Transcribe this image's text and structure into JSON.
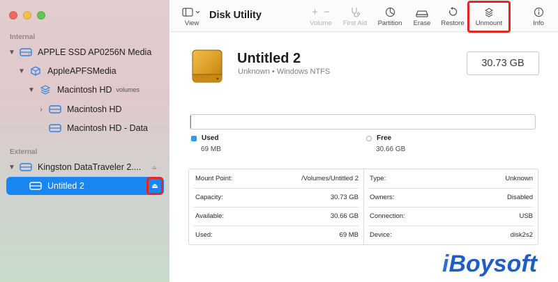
{
  "window": {
    "title": "Disk Utility"
  },
  "toolbar": {
    "view": "View",
    "volume": "Volume",
    "first_aid": "First Aid",
    "partition": "Partition",
    "erase": "Erase",
    "restore": "Restore",
    "unmount": "Unmount",
    "info": "Info"
  },
  "sidebar": {
    "internal_label": "Internal",
    "external_label": "External",
    "items": [
      {
        "label": "APPLE SSD AP0256N Media"
      },
      {
        "label": "AppleAPFSMedia"
      },
      {
        "label": "Macintosh HD",
        "suffix": "volumes"
      },
      {
        "label": "Macintosh HD"
      },
      {
        "label": "Macintosh HD - Data"
      },
      {
        "label": "Kingston DataTraveler 2...."
      },
      {
        "label": "Untitled 2"
      }
    ]
  },
  "volume": {
    "name": "Untitled 2",
    "description": "Unknown • Windows NTFS",
    "capacity": "30.73 GB",
    "used_fraction": 0.0022,
    "used_label": "Used",
    "used_value": "69 MB",
    "free_label": "Free",
    "free_value": "30.66 GB"
  },
  "info": {
    "left": [
      {
        "key": "Mount Point:",
        "value": "/Volumes/Untitled 2"
      },
      {
        "key": "Capacity:",
        "value": "30.73 GB"
      },
      {
        "key": "Available:",
        "value": "30.66 GB"
      },
      {
        "key": "Used:",
        "value": "69 MB"
      }
    ],
    "right": [
      {
        "key": "Type:",
        "value": "Unknown"
      },
      {
        "key": "Owners:",
        "value": "Disabled"
      },
      {
        "key": "Connection:",
        "value": "USB"
      },
      {
        "key": "Device:",
        "value": "disk2s2"
      }
    ]
  },
  "watermark": {
    "brand": "iBoysoft"
  },
  "colors": {
    "accent": "#1a86f2",
    "highlight_red": "#e5261d",
    "used_blue": "#2f9bf0"
  }
}
